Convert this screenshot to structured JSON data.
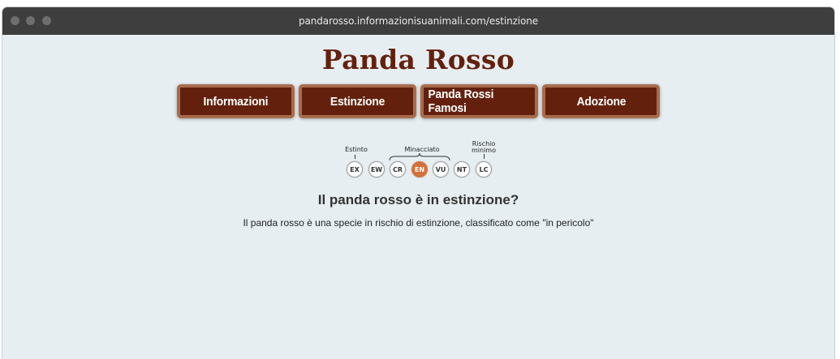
{
  "browser": {
    "url": "pandarosso.informazionisuanimali.com/estinzione"
  },
  "site": {
    "title": "Panda Rosso"
  },
  "nav": {
    "items": [
      {
        "label": "Informazioni"
      },
      {
        "label": "Estinzione"
      },
      {
        "label": "Panda Rossi Famosi"
      },
      {
        "label": "Adozione"
      }
    ]
  },
  "conservation": {
    "labels": {
      "extinct": "Estinto",
      "threatened": "Minacciato",
      "least_concern_line1": "Rischio",
      "least_concern_line2": "minimo"
    },
    "categories": [
      "EX",
      "EW",
      "CR",
      "EN",
      "VU",
      "NT",
      "LC"
    ],
    "selected": "EN",
    "colors": {
      "selected": "#d4713a"
    }
  },
  "main": {
    "question": "Il panda rosso è in estinzione?",
    "answer": "Il panda rosso è una specie in rischio di estinzione, classificato come \"in pericolo\""
  },
  "theme": {
    "title_color": "#63210d",
    "button_bg": "#63210d",
    "button_border": "#a96b4c",
    "page_bg": "#e6eef1"
  }
}
